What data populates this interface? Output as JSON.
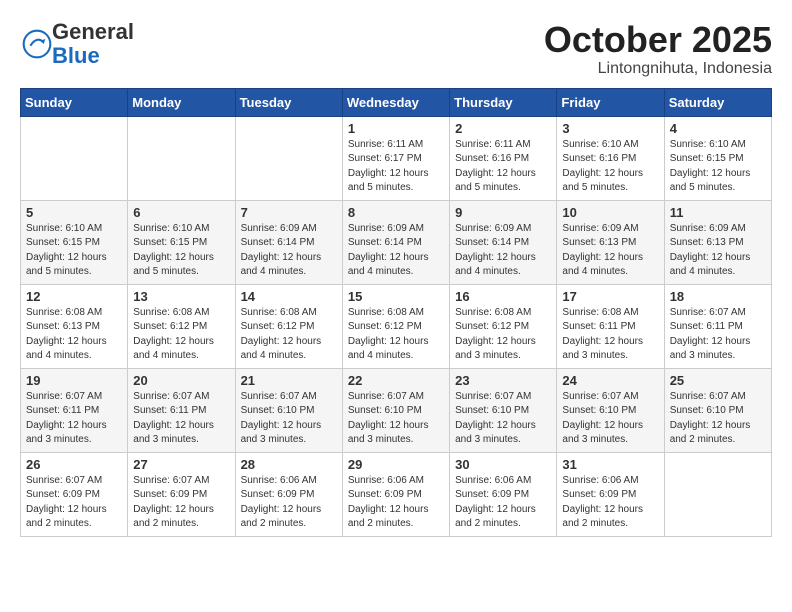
{
  "header": {
    "logo": {
      "line1": "General",
      "line2": "Blue"
    },
    "month": "October 2025",
    "location": "Lintongnihuta, Indonesia"
  },
  "weekdays": [
    "Sunday",
    "Monday",
    "Tuesday",
    "Wednesday",
    "Thursday",
    "Friday",
    "Saturday"
  ],
  "weeks": [
    [
      {
        "day": "",
        "info": ""
      },
      {
        "day": "",
        "info": ""
      },
      {
        "day": "",
        "info": ""
      },
      {
        "day": "1",
        "info": "Sunrise: 6:11 AM\nSunset: 6:17 PM\nDaylight: 12 hours\nand 5 minutes."
      },
      {
        "day": "2",
        "info": "Sunrise: 6:11 AM\nSunset: 6:16 PM\nDaylight: 12 hours\nand 5 minutes."
      },
      {
        "day": "3",
        "info": "Sunrise: 6:10 AM\nSunset: 6:16 PM\nDaylight: 12 hours\nand 5 minutes."
      },
      {
        "day": "4",
        "info": "Sunrise: 6:10 AM\nSunset: 6:15 PM\nDaylight: 12 hours\nand 5 minutes."
      }
    ],
    [
      {
        "day": "5",
        "info": "Sunrise: 6:10 AM\nSunset: 6:15 PM\nDaylight: 12 hours\nand 5 minutes."
      },
      {
        "day": "6",
        "info": "Sunrise: 6:10 AM\nSunset: 6:15 PM\nDaylight: 12 hours\nand 5 minutes."
      },
      {
        "day": "7",
        "info": "Sunrise: 6:09 AM\nSunset: 6:14 PM\nDaylight: 12 hours\nand 4 minutes."
      },
      {
        "day": "8",
        "info": "Sunrise: 6:09 AM\nSunset: 6:14 PM\nDaylight: 12 hours\nand 4 minutes."
      },
      {
        "day": "9",
        "info": "Sunrise: 6:09 AM\nSunset: 6:14 PM\nDaylight: 12 hours\nand 4 minutes."
      },
      {
        "day": "10",
        "info": "Sunrise: 6:09 AM\nSunset: 6:13 PM\nDaylight: 12 hours\nand 4 minutes."
      },
      {
        "day": "11",
        "info": "Sunrise: 6:09 AM\nSunset: 6:13 PM\nDaylight: 12 hours\nand 4 minutes."
      }
    ],
    [
      {
        "day": "12",
        "info": "Sunrise: 6:08 AM\nSunset: 6:13 PM\nDaylight: 12 hours\nand 4 minutes."
      },
      {
        "day": "13",
        "info": "Sunrise: 6:08 AM\nSunset: 6:12 PM\nDaylight: 12 hours\nand 4 minutes."
      },
      {
        "day": "14",
        "info": "Sunrise: 6:08 AM\nSunset: 6:12 PM\nDaylight: 12 hours\nand 4 minutes."
      },
      {
        "day": "15",
        "info": "Sunrise: 6:08 AM\nSunset: 6:12 PM\nDaylight: 12 hours\nand 4 minutes."
      },
      {
        "day": "16",
        "info": "Sunrise: 6:08 AM\nSunset: 6:12 PM\nDaylight: 12 hours\nand 3 minutes."
      },
      {
        "day": "17",
        "info": "Sunrise: 6:08 AM\nSunset: 6:11 PM\nDaylight: 12 hours\nand 3 minutes."
      },
      {
        "day": "18",
        "info": "Sunrise: 6:07 AM\nSunset: 6:11 PM\nDaylight: 12 hours\nand 3 minutes."
      }
    ],
    [
      {
        "day": "19",
        "info": "Sunrise: 6:07 AM\nSunset: 6:11 PM\nDaylight: 12 hours\nand 3 minutes."
      },
      {
        "day": "20",
        "info": "Sunrise: 6:07 AM\nSunset: 6:11 PM\nDaylight: 12 hours\nand 3 minutes."
      },
      {
        "day": "21",
        "info": "Sunrise: 6:07 AM\nSunset: 6:10 PM\nDaylight: 12 hours\nand 3 minutes."
      },
      {
        "day": "22",
        "info": "Sunrise: 6:07 AM\nSunset: 6:10 PM\nDaylight: 12 hours\nand 3 minutes."
      },
      {
        "day": "23",
        "info": "Sunrise: 6:07 AM\nSunset: 6:10 PM\nDaylight: 12 hours\nand 3 minutes."
      },
      {
        "day": "24",
        "info": "Sunrise: 6:07 AM\nSunset: 6:10 PM\nDaylight: 12 hours\nand 3 minutes."
      },
      {
        "day": "25",
        "info": "Sunrise: 6:07 AM\nSunset: 6:10 PM\nDaylight: 12 hours\nand 2 minutes."
      }
    ],
    [
      {
        "day": "26",
        "info": "Sunrise: 6:07 AM\nSunset: 6:09 PM\nDaylight: 12 hours\nand 2 minutes."
      },
      {
        "day": "27",
        "info": "Sunrise: 6:07 AM\nSunset: 6:09 PM\nDaylight: 12 hours\nand 2 minutes."
      },
      {
        "day": "28",
        "info": "Sunrise: 6:06 AM\nSunset: 6:09 PM\nDaylight: 12 hours\nand 2 minutes."
      },
      {
        "day": "29",
        "info": "Sunrise: 6:06 AM\nSunset: 6:09 PM\nDaylight: 12 hours\nand 2 minutes."
      },
      {
        "day": "30",
        "info": "Sunrise: 6:06 AM\nSunset: 6:09 PM\nDaylight: 12 hours\nand 2 minutes."
      },
      {
        "day": "31",
        "info": "Sunrise: 6:06 AM\nSunset: 6:09 PM\nDaylight: 12 hours\nand 2 minutes."
      },
      {
        "day": "",
        "info": ""
      }
    ]
  ]
}
